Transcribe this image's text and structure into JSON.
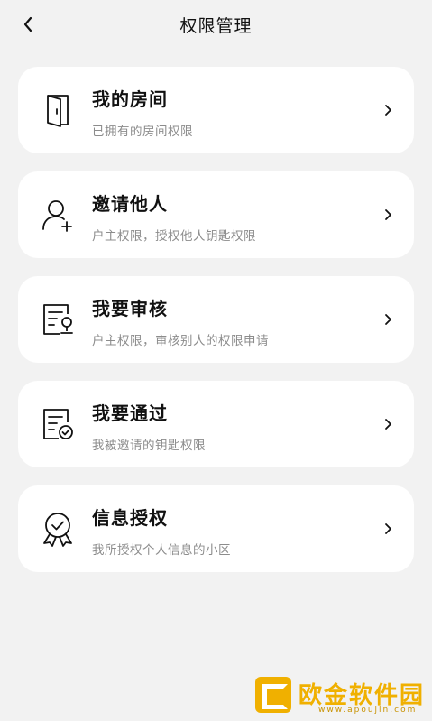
{
  "header": {
    "title": "权限管理",
    "back_icon": "chevron-left-icon"
  },
  "items": [
    {
      "title": "我的房间",
      "subtitle": "已拥有的房间权限",
      "icon": "door-icon"
    },
    {
      "title": "邀请他人",
      "subtitle": "户主权限，授权他人钥匙权限",
      "icon": "add-person-icon"
    },
    {
      "title": "我要审核",
      "subtitle": "户主权限，审核别人的权限申请",
      "icon": "review-document-icon"
    },
    {
      "title": "我要通过",
      "subtitle": "我被邀请的钥匙权限",
      "icon": "approved-document-icon"
    },
    {
      "title": "信息授权",
      "subtitle": "我所授权个人信息的小区",
      "icon": "badge-check-icon"
    }
  ],
  "watermark": {
    "text": "欧金软件园",
    "url": "www.apoujin.com"
  },
  "colors": {
    "background": "#f2f2f2",
    "card": "#ffffff",
    "subtitle": "#8c8c8c",
    "watermark": "#f0b000"
  }
}
